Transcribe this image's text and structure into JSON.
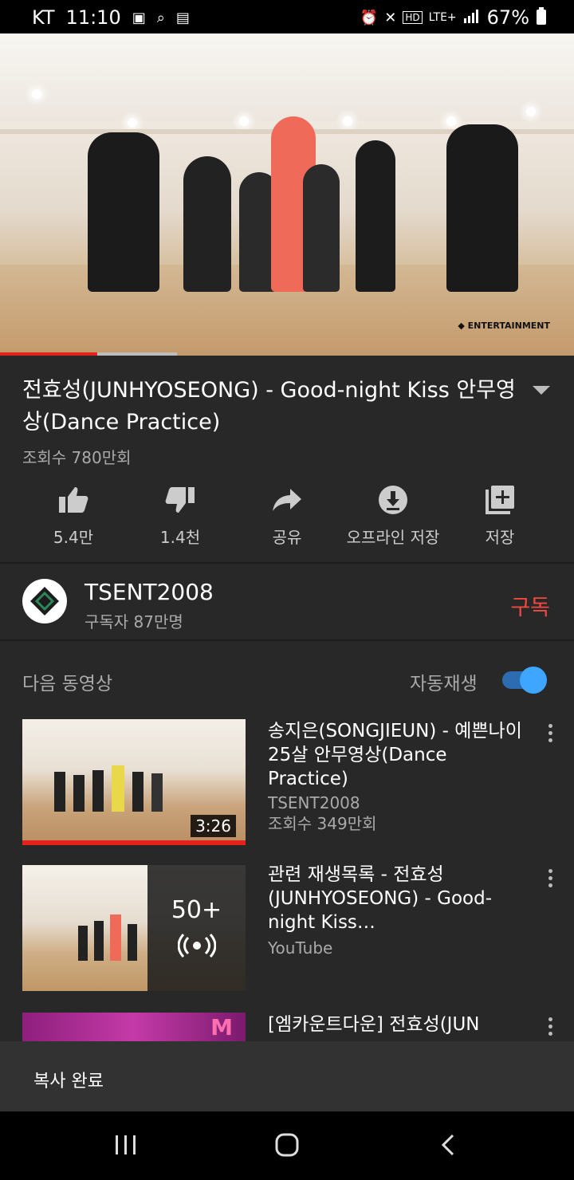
{
  "status_bar": {
    "carrier": "KT",
    "time": "11:10",
    "battery": "67%",
    "network": "LTE+",
    "icons": [
      "image-icon",
      "search-icon",
      "data-icon",
      "alarm-icon",
      "mute-icon",
      "hd-icon",
      "signal-icon",
      "battery-icon"
    ]
  },
  "player": {
    "watermark": "ENTERTAINMENT",
    "progress_fraction": 0.17,
    "buffered_fraction": 0.31,
    "accent": "#e3221b"
  },
  "video": {
    "title": "전효성(JUNHYOSEONG) - Good-night Kiss 안무영상(Dance Practice)",
    "views": "조회수 780만회"
  },
  "actions": [
    {
      "icon": "thumbs-up-icon",
      "label": "5.4만"
    },
    {
      "icon": "thumbs-down-icon",
      "label": "1.4천"
    },
    {
      "icon": "share-icon",
      "label": "공유"
    },
    {
      "icon": "download-icon",
      "label": "오프라인 저장"
    },
    {
      "icon": "add-to-playlist-icon",
      "label": "저장"
    }
  ],
  "channel": {
    "name": "TSENT2008",
    "subscribers": "구독자 87만명",
    "subscribe_label": "구독",
    "subscribe_color": "#f2493f"
  },
  "up_next": {
    "label": "다음 동영상",
    "autoplay_label": "자동재생",
    "autoplay_on": true
  },
  "recommendations": [
    {
      "title": "송지은(SONGJIEUN) - 예쁜나이 25살 안무영상(Dance Practice)",
      "channel": "TSENT2008",
      "views": "조회수 349만회",
      "duration": "3:26"
    },
    {
      "title": "관련 재생목록 - 전효성(JUNHYOSEONG) - Good-night Kiss…",
      "channel": "YouTube",
      "playlist_count": "50+"
    },
    {
      "title": "[엠카운트다운] 전효성(JUN"
    }
  ],
  "snackbar": {
    "text": "복사 완료"
  }
}
